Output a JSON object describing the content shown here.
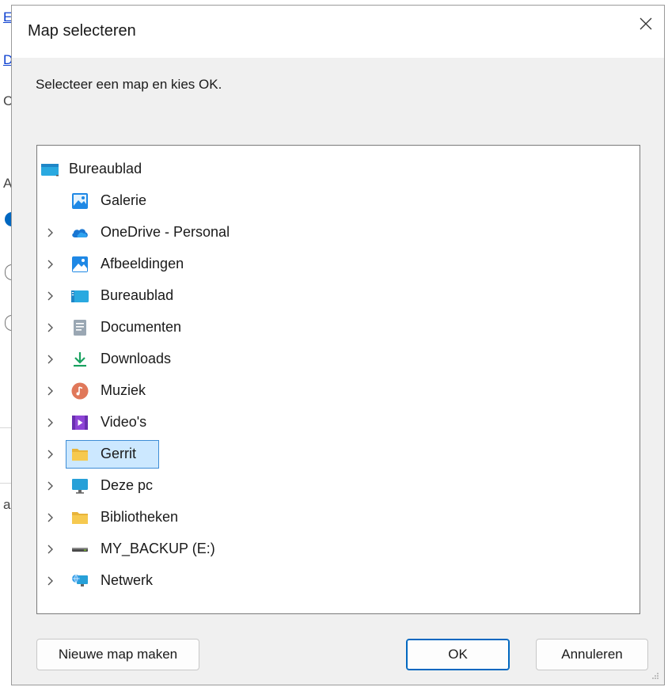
{
  "background": {
    "fragments": [
      "E",
      "D",
      "C",
      "A",
      "a"
    ]
  },
  "dialog": {
    "title": "Map selecteren",
    "instruction": "Selecteer een map en kies OK.",
    "tree": {
      "root": {
        "label": "Bureaublad",
        "icon": "desktop-icon"
      },
      "items": [
        {
          "label": "Galerie",
          "icon": "gallery-icon",
          "expandable": false
        },
        {
          "label": "OneDrive - Personal",
          "icon": "onedrive-cloud-icon",
          "expandable": true
        },
        {
          "label": "Afbeeldingen",
          "icon": "pictures-icon",
          "expandable": true
        },
        {
          "label": "Bureaublad",
          "icon": "desktop-icon",
          "expandable": true
        },
        {
          "label": "Documenten",
          "icon": "documents-icon",
          "expandable": true
        },
        {
          "label": "Downloads",
          "icon": "download-arrow-icon",
          "expandable": true
        },
        {
          "label": "Muziek",
          "icon": "music-icon",
          "expandable": true
        },
        {
          "label": "Video's",
          "icon": "video-icon",
          "expandable": true
        },
        {
          "label": "Gerrit",
          "icon": "folder-icon",
          "expandable": true,
          "selected": true
        },
        {
          "label": "Deze pc",
          "icon": "monitor-icon",
          "expandable": true
        },
        {
          "label": "Bibliotheken",
          "icon": "folder-icon",
          "expandable": true
        },
        {
          "label": "MY_BACKUP (E:)",
          "icon": "drive-icon",
          "expandable": true
        },
        {
          "label": "Netwerk",
          "icon": "network-icon",
          "expandable": true
        }
      ]
    },
    "buttons": {
      "new_folder": "Nieuwe map maken",
      "ok": "OK",
      "cancel": "Annuleren"
    }
  },
  "colors": {
    "accent": "#0067c0",
    "selection": "#cce8ff",
    "dialog_bg": "#f0f0f0"
  }
}
